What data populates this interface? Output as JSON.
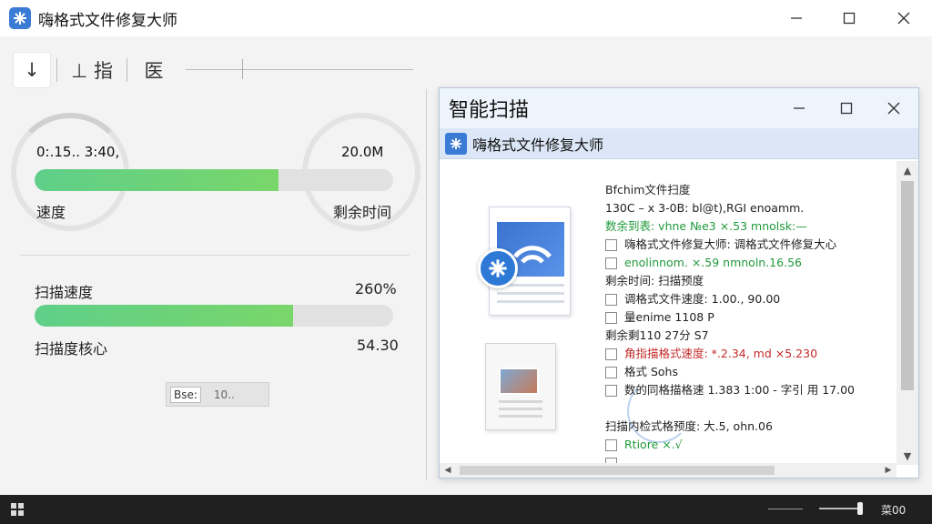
{
  "window": {
    "title": "嗨格式文件修复大师",
    "controls": {
      "minimize": "minimize",
      "maximize": "maximize",
      "close": "close"
    }
  },
  "toolbar": {
    "btn1": "↓",
    "btn2": "⊥ 指",
    "btn3": "医"
  },
  "left_panel": {
    "left_gauge_value": "0:.15.. 3:40,",
    "right_gauge_value": "20.0M",
    "top_bar_label_left": "速度",
    "top_bar_label_right": "剩余时间",
    "top_bar_progress": 0.68,
    "scan_speed_label": "扫描速度",
    "scan_speed_value": "260%",
    "scan_bar_progress": 0.72,
    "scan_core_label": "扫描度核心",
    "scan_core_value": "54.30",
    "mini_button_key": "Bse:",
    "mini_button_value": "10.."
  },
  "dialog": {
    "title": "智能扫描",
    "ribbon_title": "嗨格式文件修复大师",
    "info_lines": [
      {
        "text": "Bfchim文件扫度",
        "check": false,
        "color": ""
      },
      {
        "text": "130C – x 3-0B: bl@t),RGI enoamm.",
        "check": false,
        "color": ""
      },
      {
        "text": "数余到表: vhne №e3 ×.53 mnolsk:—",
        "check": false,
        "color": "green"
      },
      {
        "text": "嗨格式文件修复大师: 调格式文件修复大心",
        "check": true,
        "color": ""
      },
      {
        "text": "enolinnom. ×.59 nmnoln.16.56",
        "check": true,
        "color": "green"
      },
      {
        "text": "剩余时间: 扫描预度",
        "check": false,
        "color": ""
      },
      {
        "text": "调格式文件速度: 1.00., 90.00",
        "check": true,
        "color": ""
      },
      {
        "text": "量enime 1108 P",
        "check": true,
        "color": ""
      },
      {
        "text": "剩余剩110 27分 S7",
        "check": false,
        "color": ""
      },
      {
        "text": "角指描格式速度: *.2.34, md ×5.230",
        "check": true,
        "color": "red"
      },
      {
        "text": "格式 Sohs",
        "check": true,
        "color": ""
      },
      {
        "text": "数的同格描格速 1.383 1:00 - 字引 用 17.00",
        "check": true,
        "color": ""
      },
      {
        "text": "",
        "check": false,
        "color": ""
      },
      {
        "text": "扫描内检式格预度: 大.5, ohn.06",
        "check": false,
        "color": ""
      },
      {
        "text": "Rtiore ×.√",
        "check": true,
        "color": "green"
      },
      {
        "text": "",
        "check": true,
        "color": ""
      }
    ],
    "scroll_up": "▲",
    "scroll_down": "▼",
    "hscroll_left": "◀",
    "hscroll_right": "▶"
  },
  "taskbar": {
    "clock": "菜00"
  },
  "colors": {
    "accent": "#3a7bd5",
    "progress": "#5fcf89",
    "titlebar": "#ffffff",
    "dialog_ribbon": "#dbe7f7",
    "taskbar": "#202020"
  },
  "icons": {
    "app": "snowflake-tool-icon",
    "start": "start-grid-icon"
  }
}
